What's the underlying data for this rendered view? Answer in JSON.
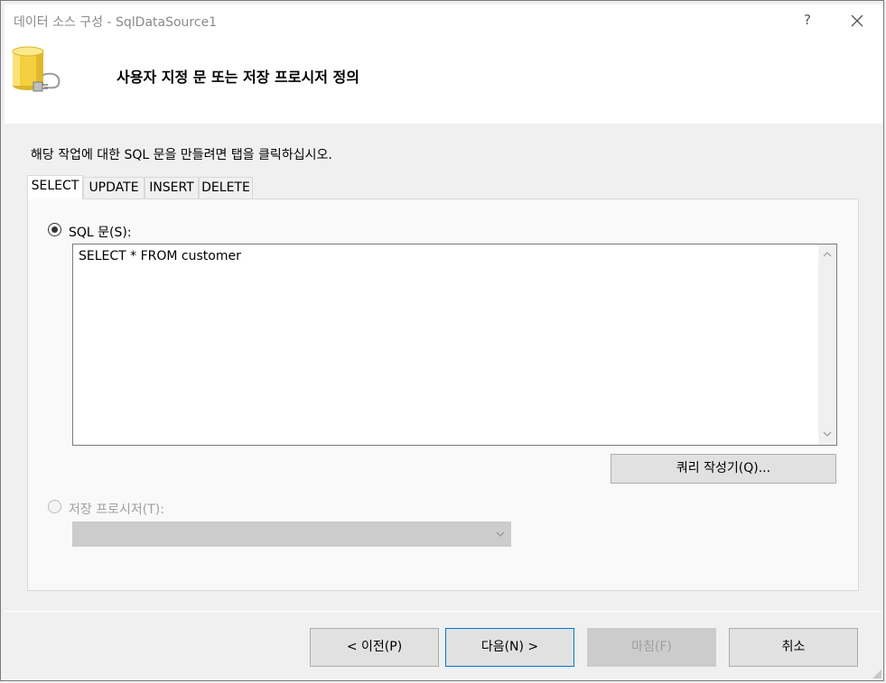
{
  "window": {
    "title": "데이터 소스 구성 - SqlDataSource1",
    "help_label": "?"
  },
  "header": {
    "title": "사용자 지정 문 또는 저장 프로시저 정의",
    "icon": "database-icon"
  },
  "instruction": "해당 작업에 대한 SQL 문을 만들려면 탭을 클릭하십시오.",
  "tabs": [
    {
      "label": "SELECT",
      "active": true
    },
    {
      "label": "UPDATE",
      "active": false
    },
    {
      "label": "INSERT",
      "active": false
    },
    {
      "label": "DELETE",
      "active": false
    }
  ],
  "sql_option": {
    "label": "SQL 문(S):",
    "selected": true,
    "text": "SELECT * FROM customer"
  },
  "query_builder_label": "쿼리 작성기(Q)...",
  "stored_proc_option": {
    "label": "저장 프로시저(T):",
    "selected": false,
    "enabled": false,
    "value": ""
  },
  "footer": {
    "prev_label": "< 이전(P)",
    "next_label": "다음(N) >",
    "finish_label": "마침(F)",
    "cancel_label": "취소"
  },
  "colors": {
    "focus_border": "#0078d7",
    "disabled_text": "#a0a0a0",
    "icon_yellow": "#f4d03f"
  }
}
